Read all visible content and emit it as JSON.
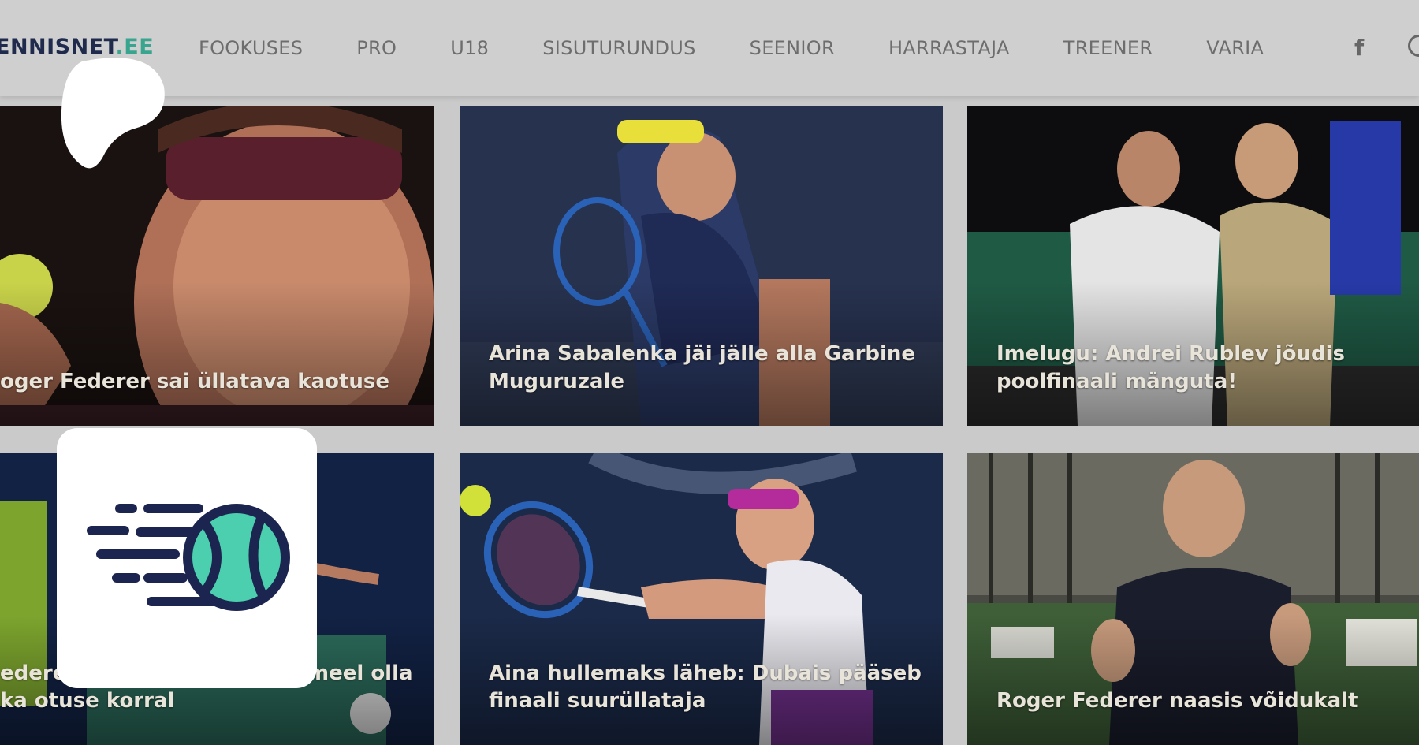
{
  "header": {
    "logo_main": "ENNISNET",
    "logo_tld": ".EE",
    "nav": [
      "FOOKUSES",
      "PRO",
      "U18",
      "SISUTURUNDUS",
      "SEENIOR",
      "HARRASTAJA",
      "TREENER",
      "VARIA"
    ],
    "facebook_glyph": "f"
  },
  "articles": [
    {
      "caption": "oger Federer sai üllatava kaotuse"
    },
    {
      "caption": "Arina Sabalenka jäi jälle alla Garbine Muguruzale"
    },
    {
      "caption": "Imelugu: Andrei Rublev jõudis poolfinaali mänguta!"
    },
    {
      "caption": "ederer: mul oleks siin hea meel olla ka otuse korral"
    },
    {
      "caption": "Aina hullemaks läheb: Dubais pääseb finaali suurüllataja"
    },
    {
      "caption": "Roger Federer naasis võidukalt"
    }
  ],
  "colors": {
    "logo_dark": "#1f2a4d",
    "logo_accent": "#3aa58f",
    "ball_teal": "#4ccfae",
    "ball_outline": "#1c2450"
  },
  "icons": {
    "tile": "tennis-ball-speed-icon",
    "blob": "speech-blob-icon"
  }
}
